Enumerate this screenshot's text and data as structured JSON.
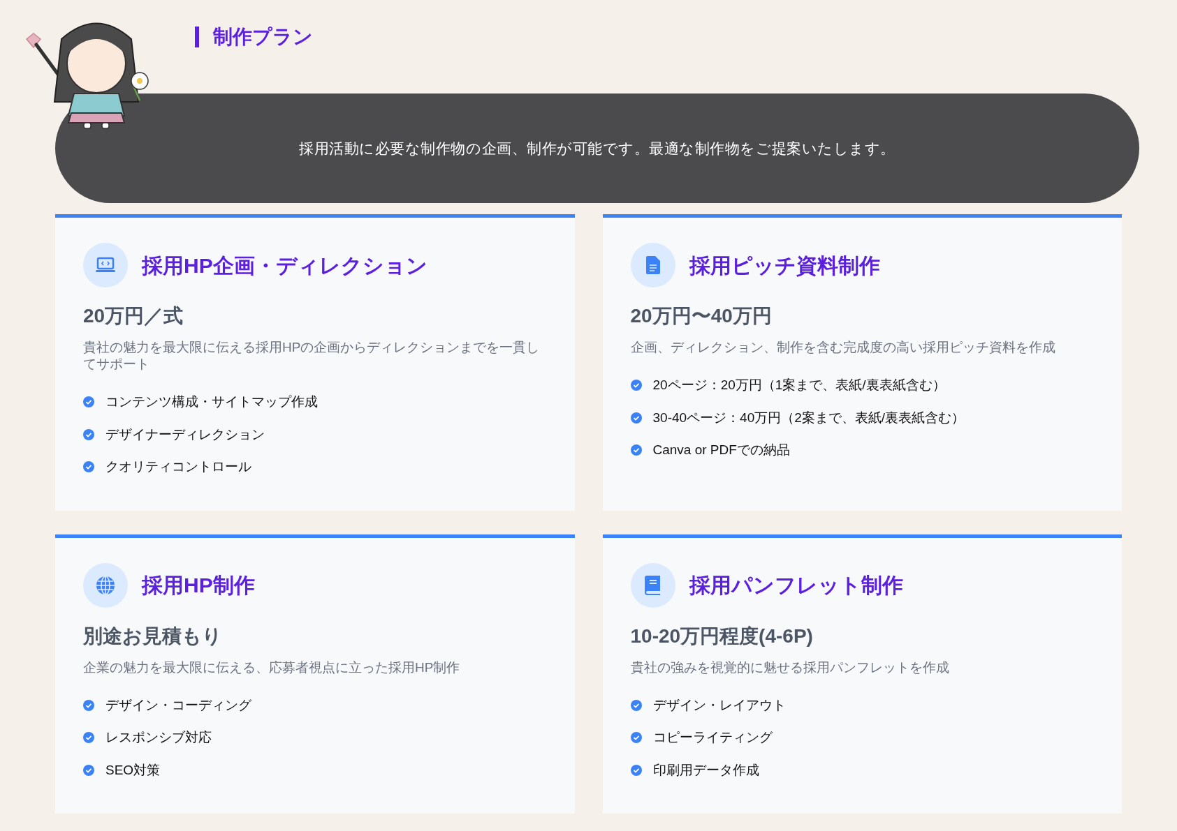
{
  "heading": "制作プラン",
  "intro": "採用活動に必要な制作物の企画、制作が可能です。最適な制作物をご提案いたします。",
  "plans": [
    {
      "title": "採用HP企画・ディレクション",
      "price": "20万円／式",
      "description": "貴社の魅力を最大限に伝える採用HPの企画からディレクションまでを一貫してサポート",
      "features": [
        "コンテンツ構成・サイトマップ作成",
        "デザイナーディレクション",
        "クオリティコントロール"
      ]
    },
    {
      "title": "採用ピッチ資料制作",
      "price": "20万円〜40万円",
      "description": "企画、ディレクション、制作を含む完成度の高い採用ピッチ資料を作成",
      "features": [
        "20ページ：20万円（1案まで、表紙/裏表紙含む）",
        "30-40ページ：40万円（2案まで、表紙/裏表紙含む）",
        "Canva or PDFでの納品"
      ]
    },
    {
      "title": "採用HP制作",
      "price": "別途お見積もり",
      "description": "企業の魅力を最大限に伝える、応募者視点に立った採用HP制作",
      "features": [
        "デザイン・コーディング",
        "レスポンシブ対応",
        "SEO対策"
      ]
    },
    {
      "title": "採用パンフレット制作",
      "price": "10-20万円程度(4-6P)",
      "description": "貴社の強みを視覚的に魅せる採用パンフレットを作成",
      "features": [
        "デザイン・レイアウト",
        "コピーライティング",
        "印刷用データ作成"
      ]
    }
  ]
}
